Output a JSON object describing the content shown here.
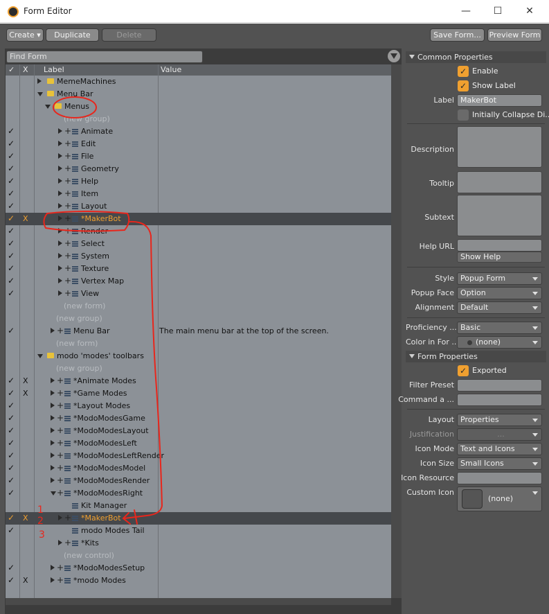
{
  "window": {
    "title": "Form Editor",
    "minimize": "—",
    "maximize": "☐",
    "close": "✕"
  },
  "toolbar": {
    "create": "Create ▾",
    "duplicate": "Duplicate",
    "delete": "Delete",
    "save_form": "Save Form...",
    "preview_form": "Preview Form"
  },
  "search": {
    "placeholder": "Find Form"
  },
  "columns": {
    "check": "✓",
    "x": "X",
    "label": "Label",
    "value": "Value"
  },
  "tree": [
    {
      "label": "MemeMachines",
      "check": "",
      "x": "",
      "indent": 0,
      "kind": "folder",
      "tri": "right"
    },
    {
      "label": "Menu Bar",
      "check": "",
      "x": "",
      "indent": 0,
      "kind": "folder",
      "tri": "down"
    },
    {
      "label": "Menus",
      "check": "",
      "x": "",
      "indent": 1,
      "kind": "folder",
      "tri": "down"
    },
    {
      "label": "(new group)",
      "check": "",
      "x": "",
      "indent": 2,
      "kind": "placeholder"
    },
    {
      "label": "Animate",
      "check": "✓",
      "x": "",
      "indent": 2,
      "kind": "list"
    },
    {
      "label": "Edit",
      "check": "✓",
      "x": "",
      "indent": 2,
      "kind": "list"
    },
    {
      "label": "File",
      "check": "✓",
      "x": "",
      "indent": 2,
      "kind": "list"
    },
    {
      "label": "Geometry",
      "check": "✓",
      "x": "",
      "indent": 2,
      "kind": "list"
    },
    {
      "label": "Help",
      "check": "✓",
      "x": "",
      "indent": 2,
      "kind": "list"
    },
    {
      "label": "Item",
      "check": "✓",
      "x": "",
      "indent": 2,
      "kind": "list"
    },
    {
      "label": "Layout",
      "check": "✓",
      "x": "",
      "indent": 2,
      "kind": "list"
    },
    {
      "label": "*MakerBot",
      "check": "✓",
      "x": "X",
      "indent": 2,
      "kind": "list",
      "selected": true
    },
    {
      "label": "Render",
      "check": "✓",
      "x": "",
      "indent": 2,
      "kind": "list"
    },
    {
      "label": "Select",
      "check": "✓",
      "x": "",
      "indent": 2,
      "kind": "list"
    },
    {
      "label": "System",
      "check": "✓",
      "x": "",
      "indent": 2,
      "kind": "list"
    },
    {
      "label": "Texture",
      "check": "✓",
      "x": "",
      "indent": 2,
      "kind": "list"
    },
    {
      "label": "Vertex Map",
      "check": "✓",
      "x": "",
      "indent": 2,
      "kind": "list"
    },
    {
      "label": "View",
      "check": "✓",
      "x": "",
      "indent": 2,
      "kind": "list"
    },
    {
      "label": "(new form)",
      "check": "",
      "x": "",
      "indent": 2,
      "kind": "placeholder"
    },
    {
      "label": "(new group)",
      "check": "",
      "x": "",
      "indent": 1,
      "kind": "placeholder"
    },
    {
      "label": "Menu Bar",
      "check": "✓",
      "x": "",
      "indent": 1,
      "kind": "list",
      "value": "The main menu bar at the top of the screen."
    },
    {
      "label": "(new form)",
      "check": "",
      "x": "",
      "indent": 1,
      "kind": "placeholder"
    },
    {
      "label": "modo 'modes' toolbars",
      "check": "",
      "x": "",
      "indent": 0,
      "kind": "folder",
      "tri": "down"
    },
    {
      "label": "(new group)",
      "check": "",
      "x": "",
      "indent": 1,
      "kind": "placeholder"
    },
    {
      "label": "*Animate Modes",
      "check": "✓",
      "x": "X",
      "indent": 1,
      "kind": "list"
    },
    {
      "label": "*Game Modes",
      "check": "✓",
      "x": "X",
      "indent": 1,
      "kind": "list"
    },
    {
      "label": "*Layout Modes",
      "check": "✓",
      "x": "",
      "indent": 1,
      "kind": "list"
    },
    {
      "label": "*ModoModesGame",
      "check": "✓",
      "x": "",
      "indent": 1,
      "kind": "list"
    },
    {
      "label": "*ModoModesLayout",
      "check": "✓",
      "x": "",
      "indent": 1,
      "kind": "list"
    },
    {
      "label": "*ModoModesLeft",
      "check": "✓",
      "x": "",
      "indent": 1,
      "kind": "list"
    },
    {
      "label": "*ModoModesLeftRender",
      "check": "✓",
      "x": "",
      "indent": 1,
      "kind": "list"
    },
    {
      "label": "*ModoModesModel",
      "check": "✓",
      "x": "",
      "indent": 1,
      "kind": "list"
    },
    {
      "label": "*ModoModesRender",
      "check": "✓",
      "x": "",
      "indent": 1,
      "kind": "list"
    },
    {
      "label": "*ModoModesRight",
      "check": "✓",
      "x": "",
      "indent": 1,
      "kind": "list",
      "tri": "down"
    },
    {
      "label": "Kit Manager",
      "check": "",
      "x": "",
      "indent": 2,
      "kind": "listonly"
    },
    {
      "label": "*MakerBot",
      "check": "✓",
      "x": "X",
      "indent": 2,
      "kind": "list",
      "selected": true
    },
    {
      "label": "modo Modes Tail",
      "check": "✓",
      "x": "",
      "indent": 2,
      "kind": "listonly"
    },
    {
      "label": "*Kits",
      "check": "",
      "x": "",
      "indent": 2,
      "kind": "list"
    },
    {
      "label": "(new control)",
      "check": "",
      "x": "",
      "indent": 2,
      "kind": "placeholder"
    },
    {
      "label": "*ModoModesSetup",
      "check": "✓",
      "x": "",
      "indent": 1,
      "kind": "list"
    },
    {
      "label": "*modo Modes",
      "check": "✓",
      "x": "X",
      "indent": 1,
      "kind": "list"
    }
  ],
  "props": {
    "common_header": "Common Properties",
    "enable": "Enable",
    "show_label": "Show Label",
    "label_label": "Label",
    "label_value": "MakerBot",
    "initially_collapse": "Initially Collapse Di...",
    "description": "Description",
    "tooltip": "Tooltip",
    "subtext": "Subtext",
    "help_url": "Help URL",
    "show_help": "Show Help",
    "style": "Style",
    "style_value": "Popup Form",
    "popup_face": "Popup Face",
    "popup_face_value": "Option",
    "alignment": "Alignment",
    "alignment_value": "Default",
    "proficiency": "Proficiency ...",
    "proficiency_value": "Basic",
    "color_in_for": "Color in For ...",
    "color_value": "(none)",
    "form_header": "Form Properties",
    "exported": "Exported",
    "filter_preset": "Filter Preset",
    "command_a": "Command a ...",
    "layout": "Layout",
    "layout_value": "Properties",
    "justification": "Justification",
    "justification_value": "...",
    "icon_mode": "Icon Mode",
    "icon_mode_value": "Text and Icons",
    "icon_size": "Icon Size",
    "icon_size_value": "Small Icons",
    "icon_resource": "Icon Resource",
    "custom_icon": "Custom Icon",
    "custom_icon_value": "(none)"
  },
  "annotations": {
    "one": "1",
    "two": "2",
    "three": "3",
    "color": "#e8261c"
  }
}
